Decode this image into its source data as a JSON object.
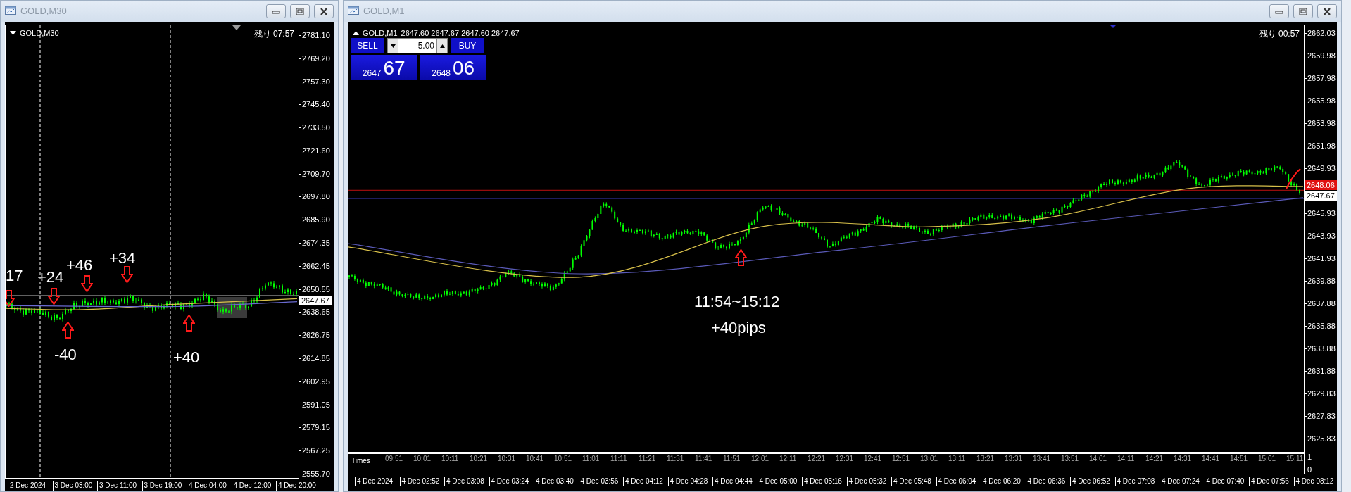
{
  "m30_window": {
    "title": "GOLD,M30",
    "chart_label": "GOLD,M30",
    "timer": "残り 07:57",
    "price_ticks": [
      "2781.10",
      "2769.20",
      "2757.30",
      "2745.40",
      "2733.50",
      "2721.60",
      "2709.70",
      "2697.80",
      "2685.90",
      "2674.35",
      "2662.45",
      "2650.55",
      "2638.65",
      "2626.75",
      "2614.85",
      "2602.95",
      "2591.05",
      "2579.15",
      "2567.25",
      "2555.70"
    ],
    "current_price_tag": "2647.67",
    "time_labels": [
      "2 Dec 2024",
      "3 Dec 03:00",
      "3 Dec 11:00",
      "3 Dec 19:00",
      "4 Dec 04:00",
      "4 Dec 12:00",
      "4 Dec 20:00"
    ],
    "annotations": [
      {
        "text": "17"
      },
      {
        "text": "+24"
      },
      {
        "text": "+46"
      },
      {
        "text": "+34"
      },
      {
        "text": "-40"
      },
      {
        "text": "+40"
      }
    ],
    "arrows": [
      {
        "kind": "down"
      },
      {
        "kind": "down"
      },
      {
        "kind": "down"
      },
      {
        "kind": "down"
      },
      {
        "kind": "up"
      },
      {
        "kind": "up"
      }
    ]
  },
  "m1_window": {
    "title": "GOLD,M1",
    "chart_label": "GOLD,M1",
    "quotes": "2647.60 2647.67 2647.60 2647.67",
    "timer": "残り 00:57",
    "trade_panel": {
      "sell_label": "SELL",
      "lot": "5.00",
      "buy_label": "BUY",
      "sell_price_head": "2647",
      "sell_price_tail": "67",
      "buy_price_head": "2648",
      "buy_price_tail": "06"
    },
    "price_ticks": [
      "2662.03",
      "2659.98",
      "2657.98",
      "2655.98",
      "2653.98",
      "2651.98",
      "2649.93",
      "2645.93",
      "2643.93",
      "2641.93",
      "2639.88",
      "2637.88",
      "2635.88",
      "2633.88",
      "2631.88",
      "2629.83",
      "2627.83",
      "2625.83"
    ],
    "ask_price_tag": "2648.06",
    "bid_price_tag": "2647.67",
    "indicator": {
      "label": "Times",
      "ticks": [
        "1",
        "0"
      ],
      "time_labels": [
        "09:51",
        "10:01",
        "10:11",
        "10:21",
        "10:31",
        "10:41",
        "10:51",
        "11:01",
        "11:11",
        "11:21",
        "11:31",
        "11:41",
        "11:51",
        "12:01",
        "12:11",
        "12:21",
        "12:31",
        "12:41",
        "12:51",
        "13:01",
        "13:11",
        "13:21",
        "13:31",
        "13:41",
        "13:51",
        "14:01",
        "14:11",
        "14:21",
        "14:31",
        "14:41",
        "14:51",
        "15:01",
        "15:11"
      ]
    },
    "time_labels": [
      "4 Dec 2024",
      "4 Dec 02:52",
      "4 Dec 03:08",
      "4 Dec 03:24",
      "4 Dec 03:40",
      "4 Dec 03:56",
      "4 Dec 04:12",
      "4 Dec 04:28",
      "4 Dec 04:44",
      "4 Dec 05:00",
      "4 Dec 05:16",
      "4 Dec 05:32",
      "4 Dec 05:48",
      "4 Dec 06:04",
      "4 Dec 06:20",
      "4 Dec 06:36",
      "4 Dec 06:52",
      "4 Dec 07:08",
      "4 Dec 07:24",
      "4 Dec 07:40",
      "4 Dec 07:56",
      "4 Dec 08:12"
    ],
    "annotations": [
      {
        "text": "11:54~15:12"
      },
      {
        "text": "+40pips"
      }
    ],
    "arrows": [
      {
        "kind": "up"
      }
    ]
  }
}
